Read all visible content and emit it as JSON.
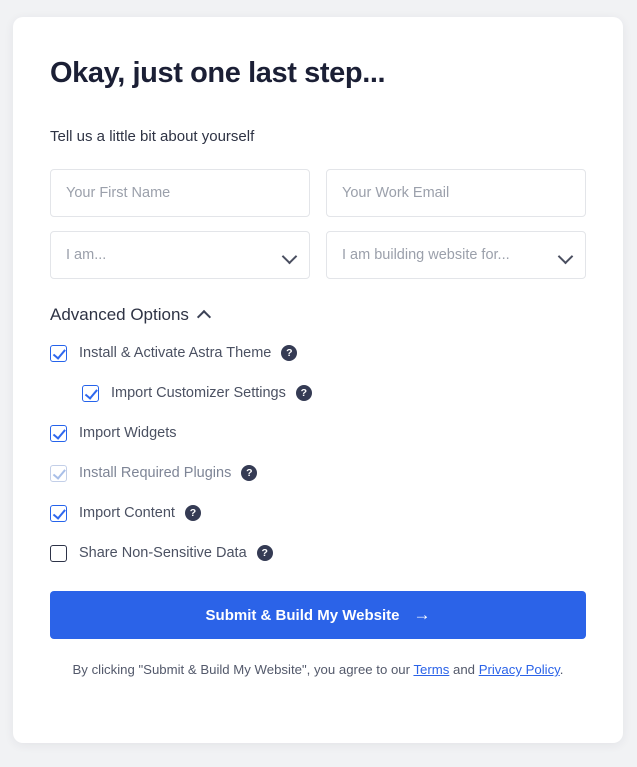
{
  "card": {
    "title": "Okay, just one last step...",
    "subtitle": "Tell us a little bit about yourself"
  },
  "form": {
    "first_name": {
      "placeholder": "Your First Name",
      "value": ""
    },
    "work_email": {
      "placeholder": "Your Work Email",
      "value": ""
    },
    "role_select": {
      "selected": "I am..."
    },
    "purpose_select": {
      "selected": "I am building website for..."
    }
  },
  "advanced": {
    "label": "Advanced Options",
    "expanded": true,
    "chevron_icon": "chevron-up-icon",
    "options": [
      {
        "label": "Install & Activate Astra Theme",
        "checked": true,
        "disabled": false,
        "indent": false,
        "help": true,
        "help_glyph": "?"
      },
      {
        "label": "Import Customizer Settings",
        "checked": true,
        "disabled": false,
        "indent": true,
        "help": true,
        "help_glyph": "?"
      },
      {
        "label": "Import Widgets",
        "checked": true,
        "disabled": false,
        "indent": false,
        "help": false,
        "help_glyph": "?"
      },
      {
        "label": "Install Required Plugins",
        "checked": true,
        "disabled": true,
        "indent": false,
        "help": true,
        "help_glyph": "?"
      },
      {
        "label": "Import Content",
        "checked": true,
        "disabled": false,
        "indent": false,
        "help": true,
        "help_glyph": "?"
      },
      {
        "label": "Share Non-Sensitive Data",
        "checked": false,
        "disabled": false,
        "indent": false,
        "help": true,
        "help_glyph": "?"
      }
    ]
  },
  "submit": {
    "label": "Submit & Build My Website",
    "arrow_icon": "arrow-right-icon",
    "arrow_glyph": "→"
  },
  "legal": {
    "prefix": "By clicking \"Submit & Build My Website\", you agree to our ",
    "terms_link": "Terms",
    "middle": " and ",
    "privacy_link": "Privacy Policy",
    "suffix": "."
  },
  "colors": {
    "accent": "#2b63e8",
    "checkbox_blue": "#2f68ee",
    "heading": "#1b1f35",
    "page_bg": "#f1f2f4",
    "help_bg": "#353b54"
  }
}
